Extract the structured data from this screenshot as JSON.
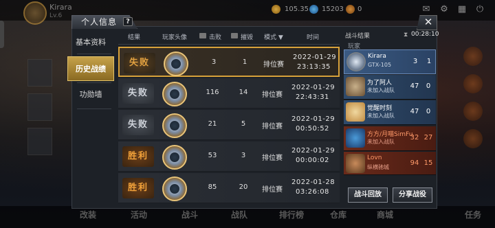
{
  "background": {
    "player_name": "Kirara",
    "player_level": "Lv.6",
    "resources": [
      "105.35",
      "15203",
      "0"
    ],
    "bottom_menu": [
      "改装",
      "活动",
      "战斗",
      "战队",
      "排行榜",
      "仓库",
      "商城",
      "任务"
    ]
  },
  "panel": {
    "title": "个人信息",
    "help": "?",
    "close": "✕"
  },
  "nav": {
    "items": [
      {
        "label": "基本资料",
        "active": false
      },
      {
        "label": "历史战绩",
        "active": true
      },
      {
        "label": "功勋墙",
        "active": false
      }
    ]
  },
  "table": {
    "headers": {
      "result": "结果",
      "avatar": "玩家头像",
      "kills": "击败",
      "destroy": "摧毁",
      "mode": "模式",
      "time": "时间"
    },
    "rows": [
      {
        "result": "失败",
        "type": "lose",
        "kills": "3",
        "destroy": "1",
        "mode": "排位赛",
        "date": "2022-01-29",
        "clock": "23:13:35",
        "selected": true
      },
      {
        "result": "失败",
        "type": "lose",
        "kills": "116",
        "destroy": "14",
        "mode": "排位赛",
        "date": "2022-01-29",
        "clock": "22:43:31",
        "selected": false
      },
      {
        "result": "失败",
        "type": "lose",
        "kills": "21",
        "destroy": "5",
        "mode": "排位赛",
        "date": "2022-01-29",
        "clock": "00:50:52",
        "selected": false
      },
      {
        "result": "胜利",
        "type": "win",
        "kills": "53",
        "destroy": "3",
        "mode": "排位赛",
        "date": "2022-01-29",
        "clock": "00:00:02",
        "selected": false
      },
      {
        "result": "胜利",
        "type": "win",
        "kills": "85",
        "destroy": "20",
        "mode": "排位赛",
        "date": "2022-01-28",
        "clock": "03:26:08",
        "selected": false
      }
    ]
  },
  "battle_result": {
    "title": "战斗结果",
    "timer": "00:28:10",
    "player_header": "玩家",
    "players": [
      {
        "name": "Kirara",
        "sub": "GTX-105",
        "kills": "3",
        "deaths": "1",
        "team": "blue",
        "me": true
      },
      {
        "name": "为了阿人",
        "sub": "未加入战队",
        "kills": "47",
        "deaths": "0",
        "team": "blue",
        "me": false
      },
      {
        "name": "觉醒时刻",
        "sub": "未加入战队",
        "kills": "47",
        "deaths": "0",
        "team": "blue",
        "me": false
      },
      {
        "name": "方方/月喵SimFu",
        "sub": "未加入战队",
        "kills": "32",
        "deaths": "27",
        "team": "red",
        "me": false
      },
      {
        "name": "Lovn",
        "sub": "纵横驰城",
        "kills": "94",
        "deaths": "15",
        "team": "red",
        "me": false
      }
    ],
    "replay_button": "战斗回放",
    "share_button": "分享战役"
  },
  "colors": {
    "accent_gold": "#d8a23a",
    "win": "#f2a23a",
    "lose": "#cfd3da",
    "team_blue": "#2f4a6a",
    "team_red": "#6a2a1a"
  }
}
